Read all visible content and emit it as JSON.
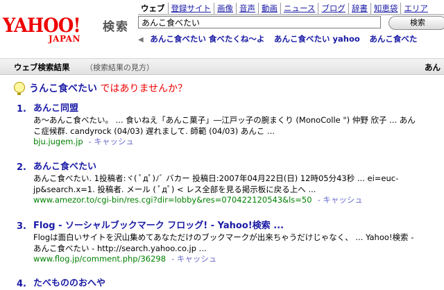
{
  "logo": {
    "word": "YAHOO!",
    "sub": "JAPAN",
    "label": "検索"
  },
  "tabs": [
    "ウェブ",
    "登録サイト",
    "画像",
    "音声",
    "動画",
    "ニュース",
    "ブログ",
    "辞書",
    "知恵袋",
    "エリア"
  ],
  "search": {
    "value": "あんこ食べたい",
    "button": "検索"
  },
  "suggest": {
    "items": [
      "あんこ食べたい 食べたくね～よ",
      "あんこ食べたい yahoo",
      "あんこ食べた"
    ]
  },
  "results_bar": {
    "title": "ウェブ検索結果",
    "help": "（検索結果の見方）",
    "right": "あん"
  },
  "did_you_mean": {
    "query": "うんこ食べたい",
    "suffix": "ではありませんか？"
  },
  "results": [
    {
      "num": "1.",
      "title": "あんこ同盟",
      "snippet": [
        "あ～あんこ食べたい。 ... 食いねえ「あんこ菓子」―江戸ッ子の腕まくり (MonoColle \") 仲野 欣子 ... あん",
        "こ症候群. candyrock (04/03) 遅れまして. 師範 (04/03) あんこ ..."
      ],
      "url": "bju.jugem.jp",
      "cache": "- キャッシュ"
    },
    {
      "num": "2.",
      "title": "あんこ食べたい",
      "snippet": [
        "あんこ食べたい. 1投稿者:ヾ( ﾟдﾟ)ﾉﾞ バカー 投稿日:2007年04月22日(日) 12時05分43秒 ... ei=euc-",
        "jp&search.x=1. 投稿者. メール ( ﾟдﾟ) < レス全部を見る掲示板に戻る上へ ..."
      ],
      "url": "www.amezor.to/cgi-bin/res.cgi?dir=lobby&res=070422120543&ls=50",
      "cache": "- キャッシュ"
    },
    {
      "num": "3.",
      "title": "Flog - ソーシャルブックマーク フロッグ! - Yahoo!検索 ...",
      "snippet": [
        "Flogは面白いサイトを沢山集めてあなただけのブックマークが出来ちゃうだけじゃなく、 ... Yahoo!検索 -",
        "あんこ食べたい - http://search.yahoo.co.jp ..."
      ],
      "url": "www.flog.jp/comment.php/36298",
      "cache": "- キャッシュ"
    },
    {
      "num": "4.",
      "title": "たべもののおへや"
    }
  ]
}
